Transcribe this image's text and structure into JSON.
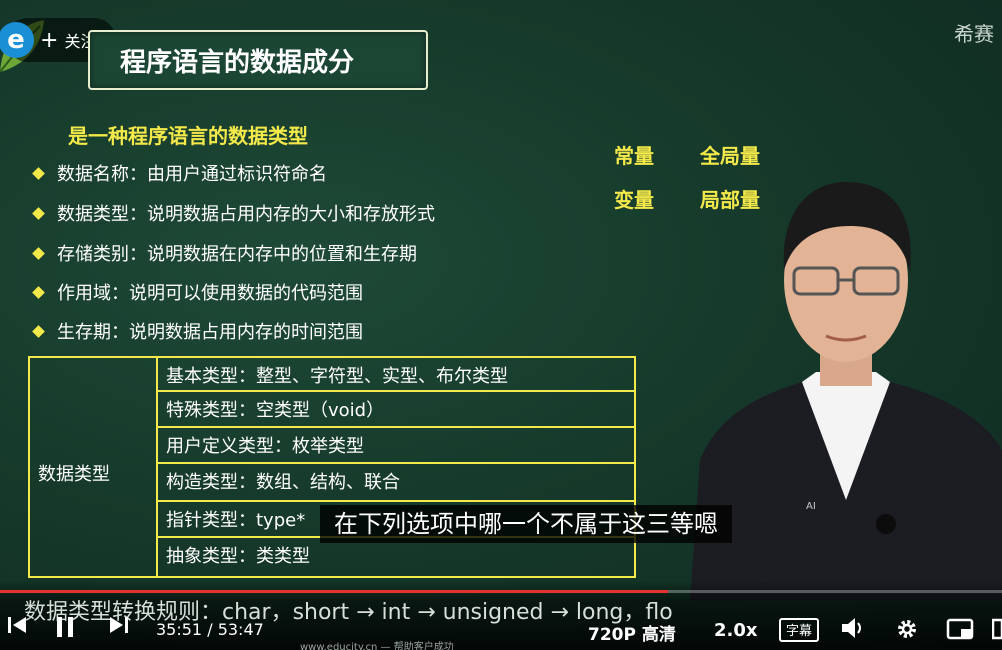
{
  "channel": {
    "logo_letter": "e",
    "follow_label": "关注",
    "brand": "希赛"
  },
  "slide": {
    "title": "程序语言的数据成分",
    "subtitle": "是一种程序语言的数据类型",
    "bullets": [
      "数据名称：由用户通过标识符命名",
      "数据类型：说明数据占用内存的大小和存放形式",
      "存储类别：说明数据在内存中的位置和生存期",
      "作用域：说明可以使用数据的代码范围",
      "生存期：说明数据占用内存的时间范围"
    ],
    "keywords": {
      "constant": "常量",
      "global": "全局量",
      "variable": "变量",
      "local": "局部量"
    },
    "table": {
      "header": "数据类型",
      "rows": [
        "基本类型：整型、字符型、实型、布尔类型",
        "特殊类型：空类型（void）",
        "用户定义类型：枚举类型",
        "构造类型：数组、结构、联合",
        "指针类型：type*",
        "抽象类型：类类型"
      ]
    },
    "rules_line": "数据类型转换规则：char，short → int → unsigned → long，flo",
    "footer_url": "www.educity.cn — 帮助客户成功"
  },
  "caption": {
    "text": "在下列选项中哪一个不属于这三等嗯",
    "ai_badge": "AI"
  },
  "player": {
    "current_time": "35:51",
    "separator": "/",
    "duration": "53:47",
    "progress": 0.6667,
    "quality": "720P 高清",
    "speed": "2.0x",
    "cc_label": "字幕",
    "accent_color": "#e33333"
  }
}
